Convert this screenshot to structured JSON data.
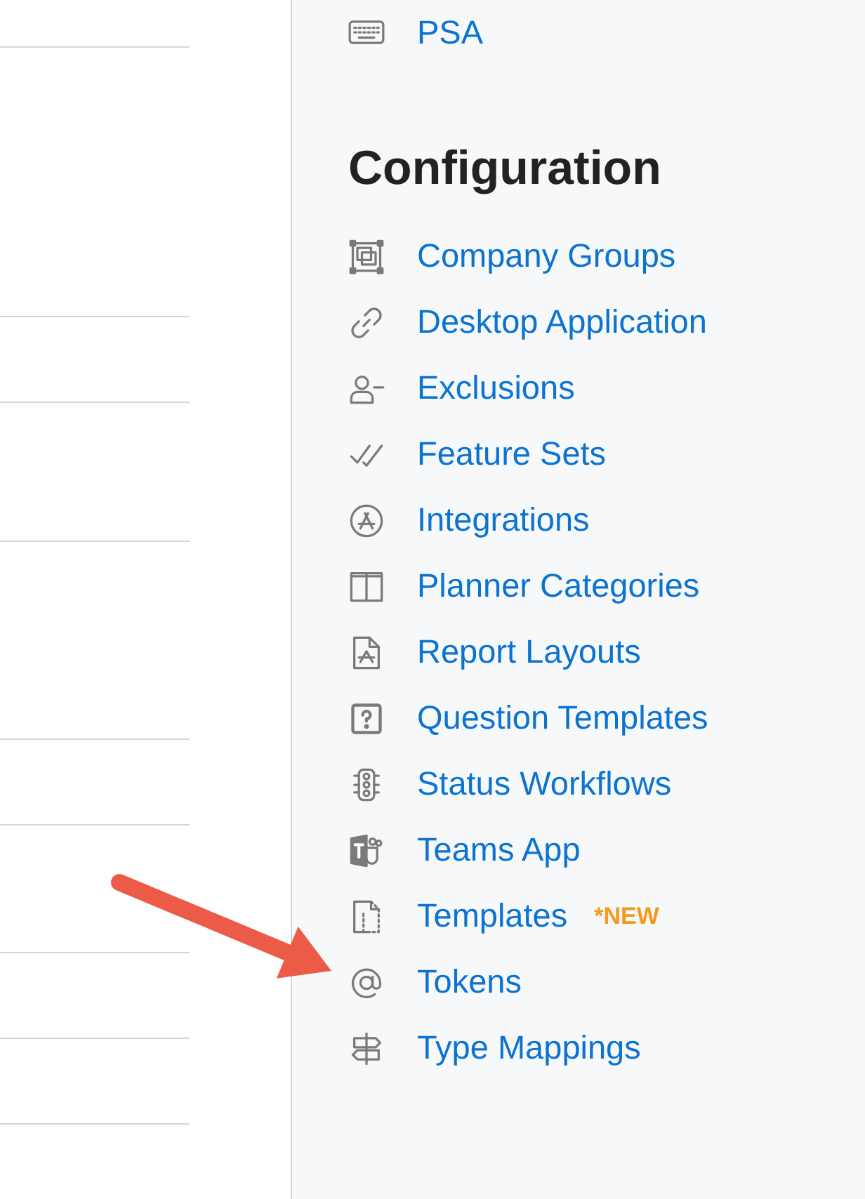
{
  "top_item": {
    "label": "PSA"
  },
  "section": {
    "title": "Configuration",
    "items": [
      {
        "label": "Company Groups",
        "pointed_at": false
      },
      {
        "label": "Desktop Application",
        "pointed_at": false
      },
      {
        "label": "Exclusions",
        "pointed_at": false
      },
      {
        "label": "Feature Sets",
        "pointed_at": false
      },
      {
        "label": "Integrations",
        "pointed_at": false
      },
      {
        "label": "Planner Categories",
        "pointed_at": false
      },
      {
        "label": "Report Layouts",
        "pointed_at": false
      },
      {
        "label": "Question Templates",
        "pointed_at": false
      },
      {
        "label": "Status Workflows",
        "pointed_at": false
      },
      {
        "label": "Teams App",
        "pointed_at": false
      },
      {
        "label": "Templates",
        "badge": "*NEW",
        "pointed_at": false
      },
      {
        "label": "Tokens",
        "pointed_at": true
      },
      {
        "label": "Type Mappings",
        "pointed_at": false
      }
    ]
  }
}
